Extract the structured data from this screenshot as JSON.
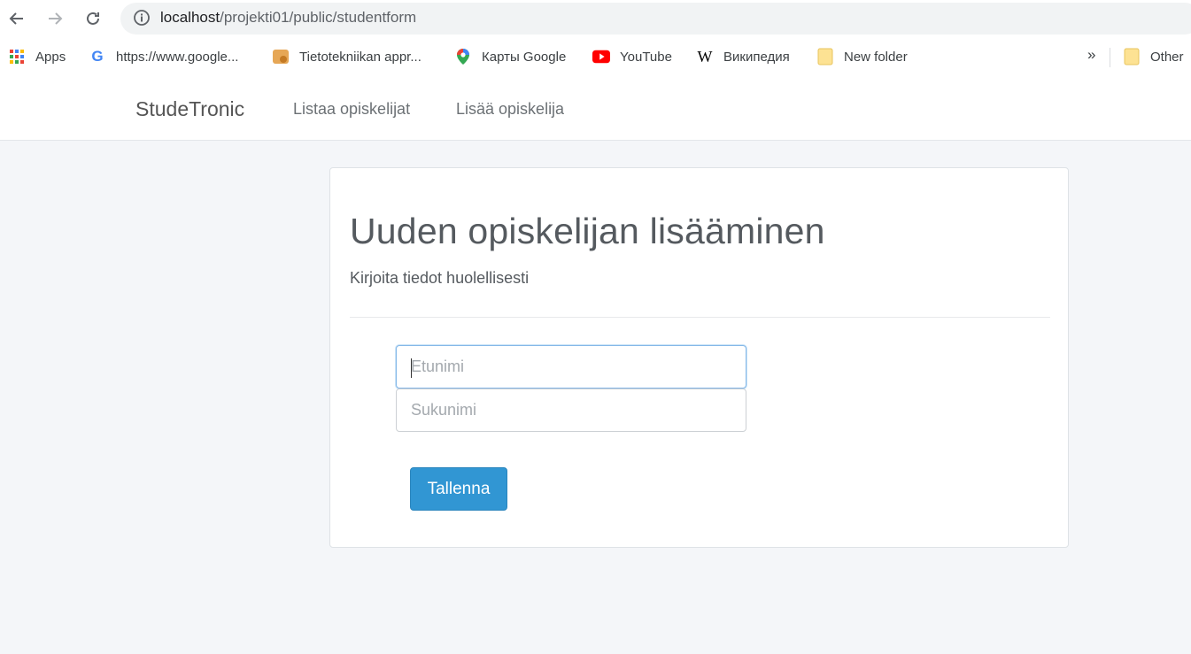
{
  "browser": {
    "url_host": "localhost",
    "url_path": "/projekti01/public/studentform",
    "bookmarks": [
      {
        "label": "Apps",
        "icon": "apps-grid-icon"
      },
      {
        "label": "https://www.google...",
        "icon": "google-icon"
      },
      {
        "label": "Tietotekniikan appr...",
        "icon": "site-icon"
      },
      {
        "label": "Карты Google",
        "icon": "maps-pin-icon"
      },
      {
        "label": "YouTube",
        "icon": "youtube-icon"
      },
      {
        "label": "Википедия",
        "icon": "wikipedia-icon"
      },
      {
        "label": "New folder",
        "icon": "folder-icon"
      }
    ],
    "overflow_label": "»",
    "other_label": "Other"
  },
  "navbar": {
    "brand": "StudeTronic",
    "links": [
      "Listaa opiskelijat",
      "Lisää opiskelija"
    ]
  },
  "form": {
    "title": "Uuden opiskelijan lisääminen",
    "subtitle": "Kirjoita tiedot huolellisesti",
    "first_name_placeholder": "Etunimi",
    "last_name_placeholder": "Sukunimi",
    "submit_label": "Tallenna"
  },
  "colors": {
    "accent": "#3196d3",
    "page_bg": "#f4f6f9"
  }
}
